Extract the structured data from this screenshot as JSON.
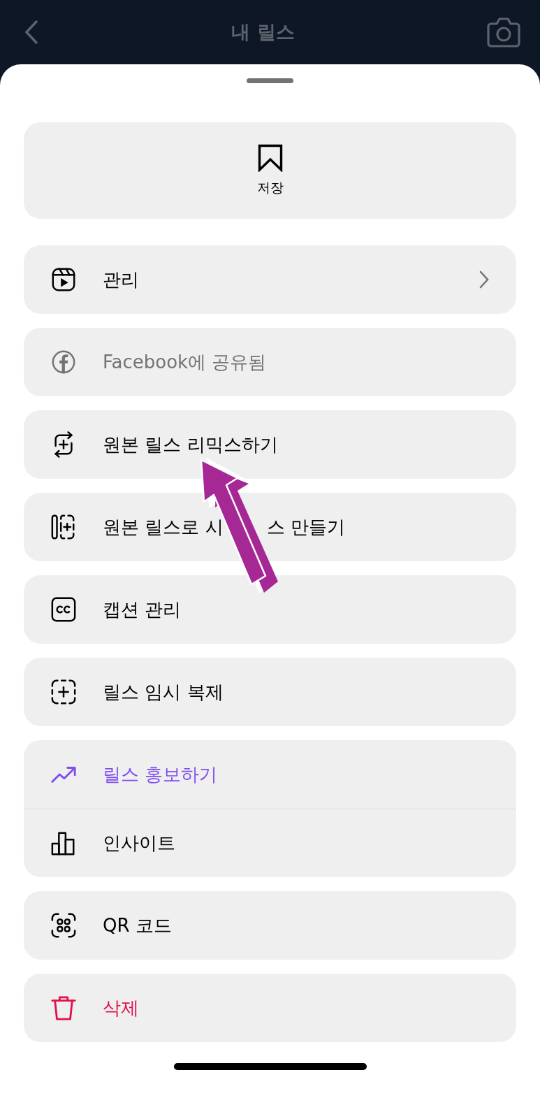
{
  "header": {
    "title": "내 릴스"
  },
  "save": {
    "label": "저장"
  },
  "sections": [
    {
      "items": [
        {
          "kind": "manage",
          "label": "관리",
          "color": "#000000",
          "chevron": true
        }
      ]
    },
    {
      "items": [
        {
          "kind": "facebook",
          "label": "Facebook에 공유됨",
          "color": "#737373",
          "chevron": false
        }
      ]
    },
    {
      "items": [
        {
          "kind": "remix",
          "label": "원본 릴스 리믹스하기",
          "color": "#000000",
          "chevron": false
        }
      ]
    },
    {
      "items": [
        {
          "kind": "sequence",
          "label": "원본 릴스로 시",
          "label_tail": "스 만들기",
          "color": "#000000",
          "chevron": false
        }
      ]
    },
    {
      "items": [
        {
          "kind": "captions",
          "label": "캡션 관리",
          "color": "#000000",
          "chevron": false
        }
      ]
    },
    {
      "items": [
        {
          "kind": "duplicate",
          "label": "릴스 임시 복제",
          "color": "#000000",
          "chevron": false
        }
      ]
    },
    {
      "items": [
        {
          "kind": "promote",
          "label": "릴스 홍보하기",
          "color": "#7e4cf0",
          "chevron": false
        },
        {
          "kind": "insights",
          "label": "인사이트",
          "color": "#000000",
          "chevron": false
        }
      ]
    },
    {
      "items": [
        {
          "kind": "qr",
          "label": "QR 코드",
          "color": "#000000",
          "chevron": false
        }
      ]
    },
    {
      "items": [
        {
          "kind": "delete",
          "label": "삭제",
          "color": "#e0134b",
          "chevron": false
        }
      ]
    }
  ]
}
